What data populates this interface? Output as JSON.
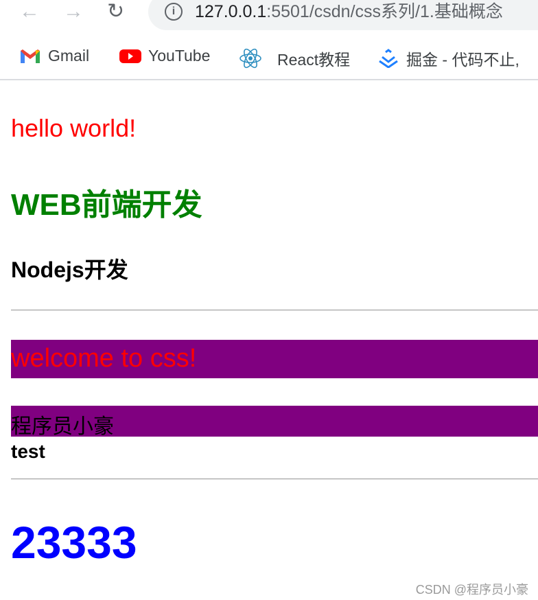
{
  "browser": {
    "url_host": "127.0.0.1",
    "url_rest": ":5501/csdn/css系列/1.基础概念",
    "bookmarks": [
      {
        "label": "Gmail",
        "icon": "gmail-icon"
      },
      {
        "label": "YouTube",
        "icon": "youtube-icon"
      },
      {
        "label": "React教程",
        "icon": "react-icon"
      },
      {
        "label": "掘金 - 代码不止,",
        "icon": "juejin-icon"
      }
    ]
  },
  "content": {
    "hello": "hello world!",
    "h_web": "WEB前端开发",
    "h_node": "Nodejs开发",
    "welcome": "welcome to css!",
    "author": "程序员小豪",
    "test": "test",
    "number": "23333"
  },
  "watermark": "CSDN @程序员小豪",
  "colors": {
    "red": "#ff0000",
    "green": "#008000",
    "purple": "#800080",
    "blue": "#0000ff"
  }
}
